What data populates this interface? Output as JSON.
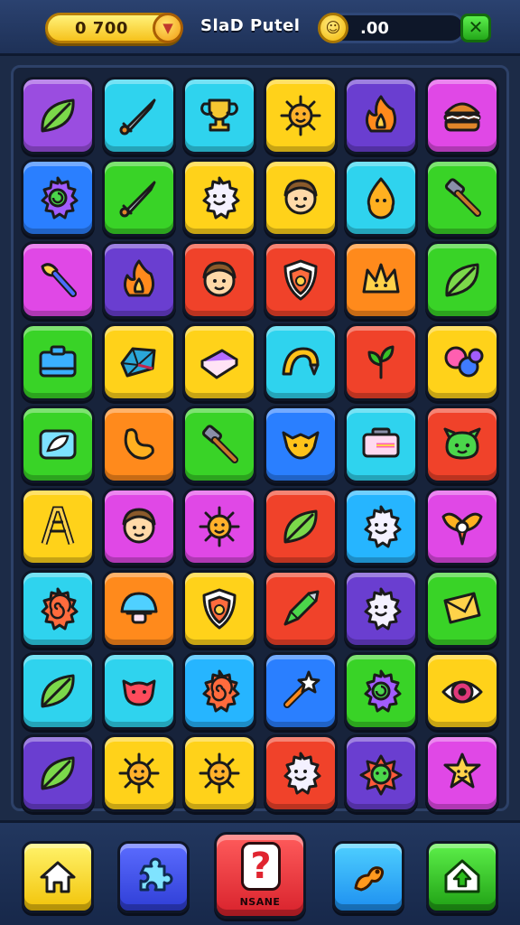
{
  "header": {
    "coins": "0 700",
    "title": "SlaD Putel",
    "score": ".00"
  },
  "colors": {
    "purple": "#9a4de0",
    "cyan": "#2fd3ee",
    "yellow": "#ffd21a",
    "orange": "#ff8a1c",
    "red": "#f0422a",
    "green": "#39d327",
    "blue": "#2a7fff",
    "magenta": "#e048e6",
    "violet": "#6a3ed0",
    "sky": "#26b5ff"
  },
  "board": {
    "rows": [
      [
        {
          "color": "purple",
          "icon": "leaf-icon"
        },
        {
          "color": "cyan",
          "icon": "sword-icon"
        },
        {
          "color": "cyan",
          "icon": "trophy-icon"
        },
        {
          "color": "yellow",
          "icon": "sun-icon"
        },
        {
          "color": "violet",
          "icon": "fire-icon"
        },
        {
          "color": "magenta",
          "icon": "burger-icon"
        }
      ],
      [
        {
          "color": "blue",
          "icon": "gear-icon"
        },
        {
          "color": "green",
          "icon": "sword-icon"
        },
        {
          "color": "yellow",
          "icon": "smiley-gear-icon"
        },
        {
          "color": "yellow",
          "icon": "face-icon"
        },
        {
          "color": "cyan",
          "icon": "drop-icon"
        },
        {
          "color": "green",
          "icon": "hammer-icon"
        }
      ],
      [
        {
          "color": "magenta",
          "icon": "brush-icon"
        },
        {
          "color": "violet",
          "icon": "fire-icon"
        },
        {
          "color": "red",
          "icon": "face-icon"
        },
        {
          "color": "red",
          "icon": "shield-icon"
        },
        {
          "color": "orange",
          "icon": "crown-icon"
        },
        {
          "color": "green",
          "icon": "leaf-icon"
        }
      ],
      [
        {
          "color": "green",
          "icon": "box-icon"
        },
        {
          "color": "yellow",
          "icon": "gem-icon"
        },
        {
          "color": "yellow",
          "icon": "book-icon"
        },
        {
          "color": "cyan",
          "icon": "arch-icon"
        },
        {
          "color": "red",
          "icon": "sprout-icon"
        },
        {
          "color": "yellow",
          "icon": "balls-icon"
        }
      ],
      [
        {
          "color": "green",
          "icon": "card-icon"
        },
        {
          "color": "orange",
          "icon": "bean-icon"
        },
        {
          "color": "green",
          "icon": "hammer-icon"
        },
        {
          "color": "blue",
          "icon": "fox-icon"
        },
        {
          "color": "cyan",
          "icon": "ticket-icon"
        },
        {
          "color": "red",
          "icon": "dragon-icon"
        }
      ],
      [
        {
          "color": "yellow",
          "icon": "ladder-icon"
        },
        {
          "color": "magenta",
          "icon": "face-icon"
        },
        {
          "color": "magenta",
          "icon": "sun-icon"
        },
        {
          "color": "red",
          "icon": "leaf-icon"
        },
        {
          "color": "sky",
          "icon": "smiley-gear-icon"
        },
        {
          "color": "magenta",
          "icon": "wings-icon"
        }
      ],
      [
        {
          "color": "cyan",
          "icon": "spiral-gear-icon"
        },
        {
          "color": "orange",
          "icon": "mushroom-icon"
        },
        {
          "color": "yellow",
          "icon": "shield-icon"
        },
        {
          "color": "red",
          "icon": "arrow-icon"
        },
        {
          "color": "violet",
          "icon": "smiley-gear-icon"
        },
        {
          "color": "green",
          "icon": "envelope-icon"
        }
      ],
      [
        {
          "color": "cyan",
          "icon": "leaf-icon"
        },
        {
          "color": "cyan",
          "icon": "cat-icon"
        },
        {
          "color": "sky",
          "icon": "spiral-gear-icon"
        },
        {
          "color": "blue",
          "icon": "wand-icon"
        },
        {
          "color": "green",
          "icon": "gear-icon"
        },
        {
          "color": "yellow",
          "icon": "eye-icon"
        }
      ],
      [
        {
          "color": "violet",
          "icon": "leaf-icon"
        },
        {
          "color": "yellow",
          "icon": "sun-icon"
        },
        {
          "color": "yellow",
          "icon": "sun-icon"
        },
        {
          "color": "red",
          "icon": "smiley-gear-icon"
        },
        {
          "color": "violet",
          "icon": "flower-icon"
        },
        {
          "color": "magenta",
          "icon": "star-face-icon"
        }
      ]
    ]
  },
  "footer": {
    "center_label": "NSANE"
  }
}
